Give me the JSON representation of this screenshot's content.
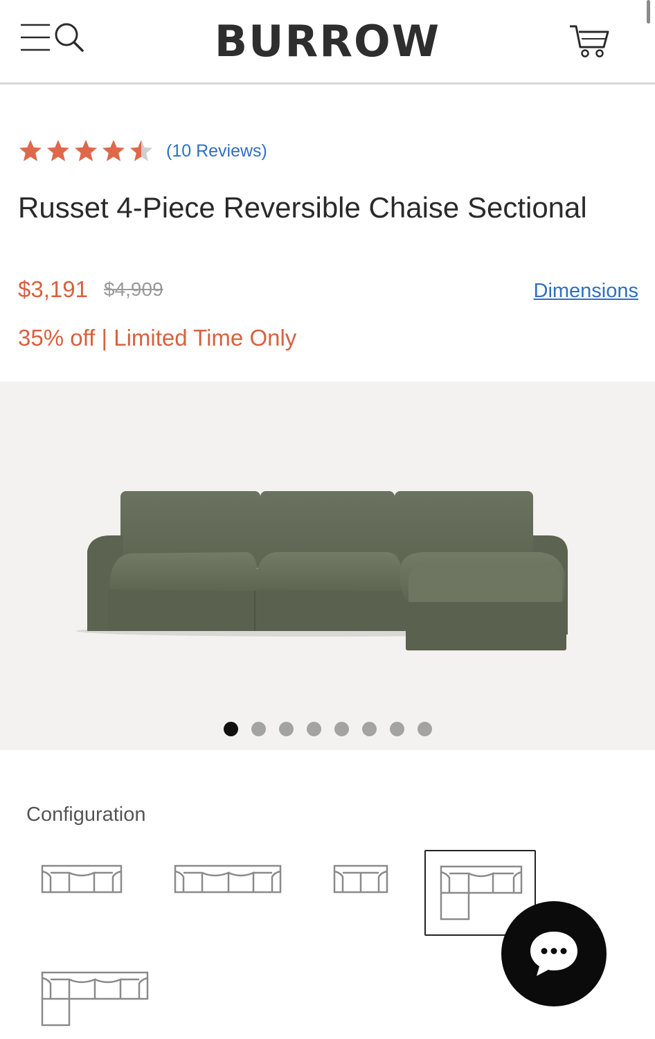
{
  "header": {
    "brand": "BURROW",
    "menu_icon": "hamburger-menu-icon",
    "search_icon": "search-icon",
    "cart_icon": "shopping-cart-icon"
  },
  "product": {
    "rating": 4.5,
    "rating_max": 5,
    "reviews_label": "(10 Reviews)",
    "title": "Russet 4-Piece Reversible Chaise Sectional",
    "price": "$3,191",
    "original_price": "$4,909",
    "dimensions_label": "Dimensions",
    "promo": "35% off | Limited Time Only"
  },
  "colors": {
    "accent": "#d9603f",
    "link": "#2f6fc2",
    "star": "#e0684a",
    "sofa": "#646b56"
  },
  "gallery": {
    "image": "olive green sectional sofa with chaise",
    "slide_count": 8,
    "active_slide": 1
  },
  "configuration": {
    "label": "Configuration",
    "options": [
      "3-seat sofa",
      "4-seat sofa",
      "2-seat loveseat",
      "4-piece chaise sectional",
      "4-piece L sectional"
    ],
    "selected_index": 3
  },
  "chat": {
    "icon": "chat-bubble-icon"
  }
}
